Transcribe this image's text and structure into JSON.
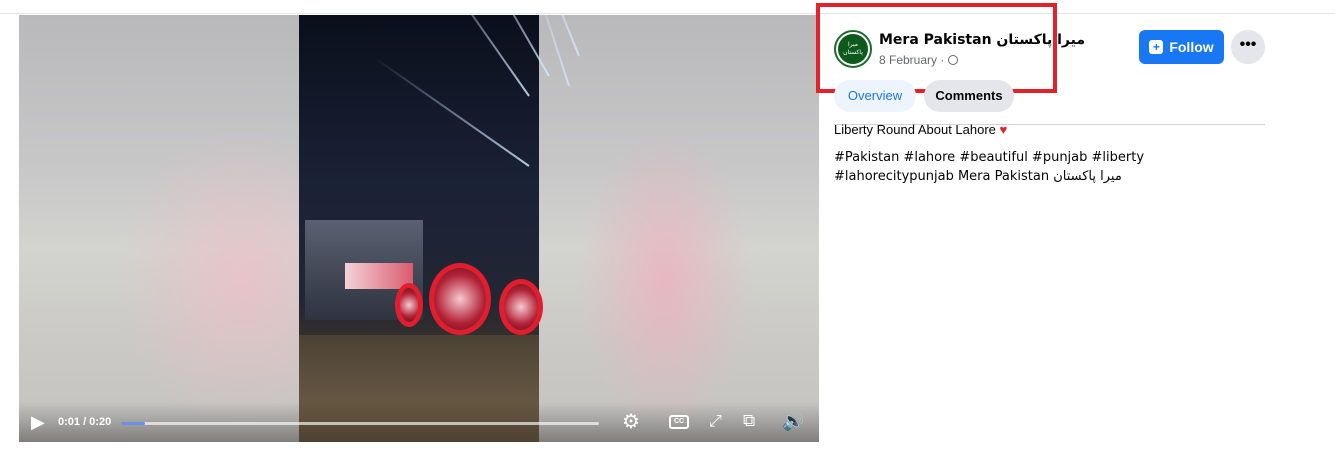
{
  "video": {
    "time_label": "0:01 / 0:20",
    "progress": 0.05
  },
  "post": {
    "page_name": "Mera Pakistan میرا پاکستان",
    "avatar_text": "میرا پاکستان",
    "date": "8 February",
    "date_sep": " · ",
    "follow_label": "Follow",
    "more_label": "•••"
  },
  "tabs": [
    {
      "label": "Overview",
      "active": true
    },
    {
      "label": "Comments",
      "active": false
    }
  ],
  "caption": {
    "text": "Liberty Round About Lahore",
    "emoji": "♥"
  },
  "hashtags": {
    "line1": "#Pakistan #lahore #beautiful #punjab #liberty",
    "line2": "#lahorecitypunjab Mera Pakistan میرا پاکستان"
  },
  "colors": {
    "accent": "#1877f2",
    "highlight_box": "#e3222b"
  },
  "icons": {
    "play": "play-icon",
    "settings": "gear-icon",
    "captions": "cc-icon",
    "fullscreen": "expand-icon",
    "miniplayer": "miniplayer-icon",
    "volume": "volume-icon",
    "globe": "globe-icon",
    "follow": "follow-icon",
    "more": "more-icon"
  }
}
